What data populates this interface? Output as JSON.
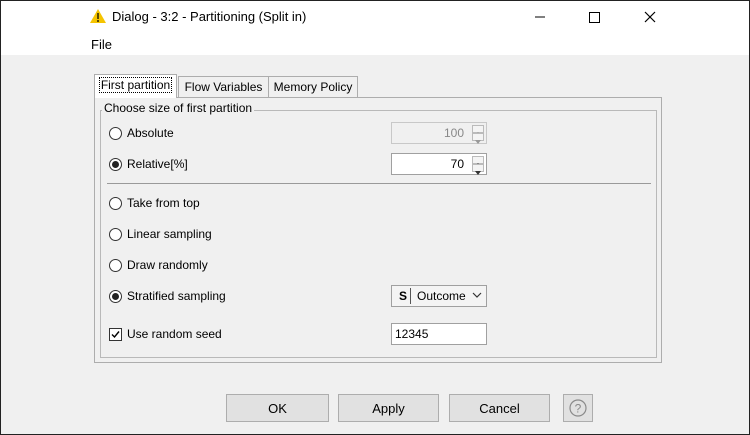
{
  "window": {
    "title": "Dialog - 3:2 - Partitioning (Split in)"
  },
  "menu": {
    "file_label": "File"
  },
  "tabs": [
    {
      "label": "First partition",
      "active": true
    },
    {
      "label": "Flow Variables",
      "active": false
    },
    {
      "label": "Memory Policy",
      "active": false
    }
  ],
  "partition": {
    "group_title": "Choose size of first partition",
    "absolute": {
      "label": "Absolute",
      "selected": false,
      "value": "100",
      "enabled": false
    },
    "relative": {
      "label": "Relative[%]",
      "selected": true,
      "value": "70",
      "enabled": true
    }
  },
  "sampling": {
    "take_from_top": {
      "label": "Take from top",
      "selected": false
    },
    "linear": {
      "label": "Linear sampling",
      "selected": false
    },
    "draw_randomly": {
      "label": "Draw randomly",
      "selected": false
    },
    "stratified": {
      "label": "Stratified sampling",
      "selected": true,
      "column_type_badge": "S",
      "column": "Outcome"
    }
  },
  "seed": {
    "label": "Use random seed",
    "checked": true,
    "value": "12345"
  },
  "buttons": {
    "ok": "OK",
    "apply": "Apply",
    "cancel": "Cancel"
  },
  "icons": {
    "app": "knime-warning-triangle-icon",
    "minimize": "minimize-icon",
    "maximize": "maximize-icon",
    "close": "close-icon",
    "help": "help-question-icon"
  },
  "colors": {
    "app_icon": "#f5c400",
    "window_bg": "#f0f0f0",
    "titlebar_bg": "#ffffff"
  }
}
